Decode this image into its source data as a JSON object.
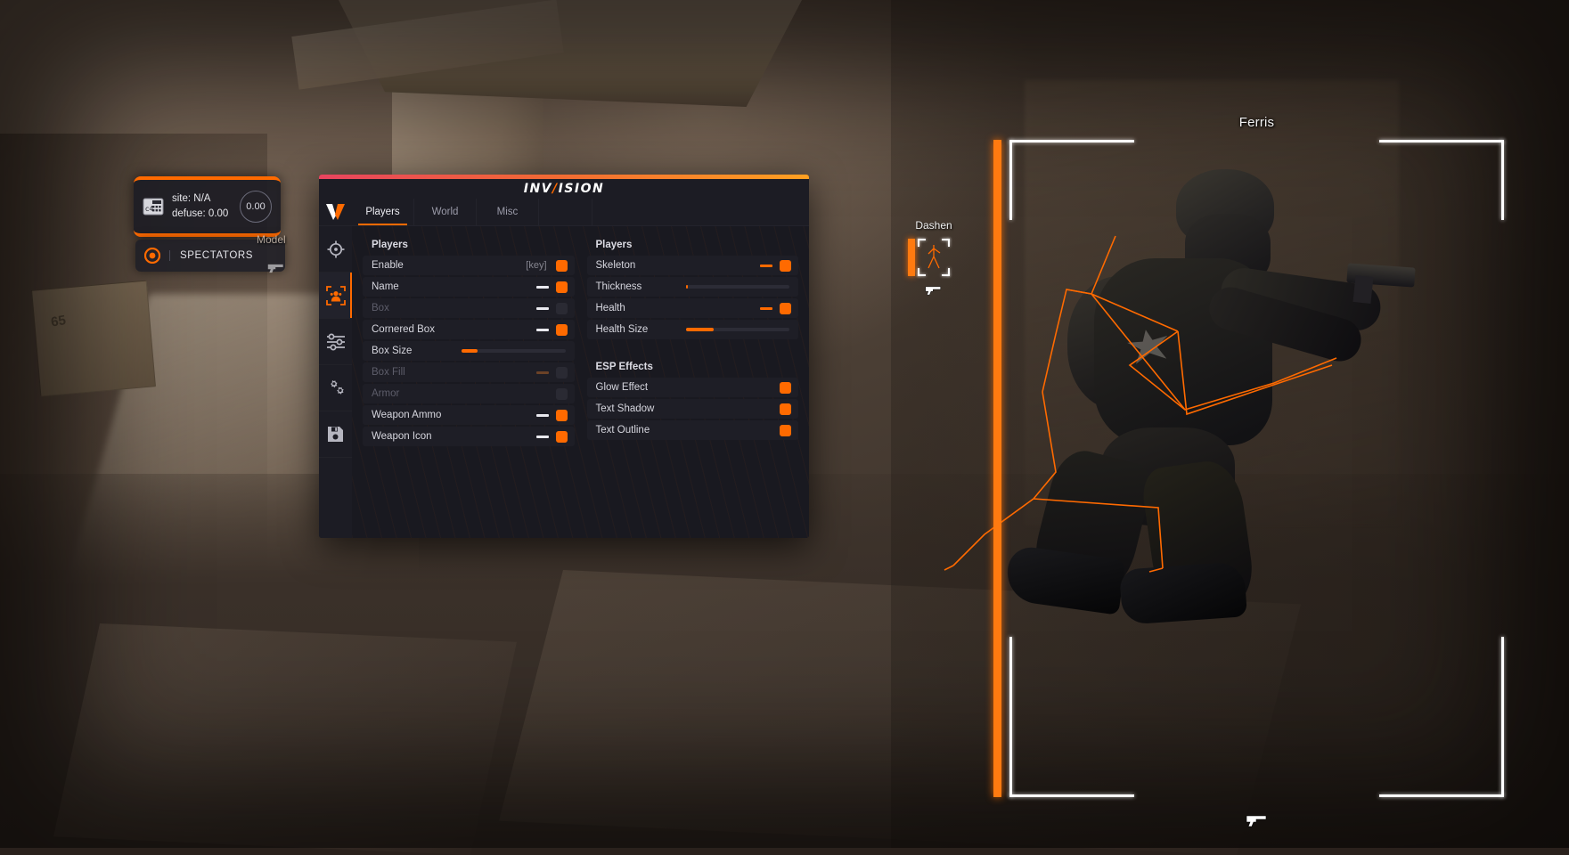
{
  "menu": {
    "brand_pre": "INV",
    "brand_slash": "/",
    "brand_post": "ISION",
    "tabs": [
      {
        "label": "Players",
        "active": true
      },
      {
        "label": "World",
        "active": false
      },
      {
        "label": "Misc",
        "active": false
      }
    ],
    "rail": [
      {
        "icon": "crosshair-icon",
        "active": false
      },
      {
        "icon": "player-esp-icon",
        "active": true
      },
      {
        "icon": "sliders-icon",
        "active": false
      },
      {
        "icon": "gears-icon",
        "active": false
      },
      {
        "icon": "save-icon",
        "active": false
      }
    ],
    "left_column": {
      "group_title": "Players",
      "rows": [
        {
          "label": "Enable",
          "type": "toggle",
          "keybind": "[key]",
          "toggle": true,
          "disabled": false
        },
        {
          "label": "Name",
          "type": "toggle",
          "dash": "white",
          "toggle": true,
          "disabled": false
        },
        {
          "label": "Box",
          "type": "toggle",
          "dash": "white",
          "toggle": false,
          "disabled": true
        },
        {
          "label": "Cornered Box",
          "type": "toggle",
          "dash": "white",
          "toggle": true,
          "disabled": false
        },
        {
          "label": "Box Size",
          "type": "slider",
          "value": 15,
          "disabled": false
        },
        {
          "label": "Box Fill",
          "type": "toggle",
          "dash": "dim",
          "toggle": false,
          "disabled": true
        },
        {
          "label": "Armor",
          "type": "toggle",
          "toggle": false,
          "disabled": true
        },
        {
          "label": "Weapon Ammo",
          "type": "toggle",
          "dash": "white",
          "toggle": true,
          "disabled": false
        },
        {
          "label": "Weapon Icon",
          "type": "toggle",
          "dash": "white",
          "toggle": true,
          "disabled": false
        }
      ]
    },
    "right_column": {
      "group_title": "Players",
      "rows": [
        {
          "label": "Skeleton",
          "type": "toggle",
          "dash": "orange",
          "toggle": true,
          "disabled": false
        },
        {
          "label": "Thickness",
          "type": "slider",
          "value": 2,
          "disabled": false
        },
        {
          "label": "Health",
          "type": "toggle",
          "dash": "orange",
          "toggle": true,
          "disabled": false
        },
        {
          "label": "Health Size",
          "type": "slider",
          "value": 27,
          "disabled": false
        }
      ],
      "effects_title": "ESP Effects",
      "effects_rows": [
        {
          "label": "Glow Effect",
          "type": "toggle",
          "toggle": true,
          "disabled": false
        },
        {
          "label": "Text Shadow",
          "type": "toggle",
          "toggle": true,
          "disabled": false
        },
        {
          "label": "Text Outline",
          "type": "toggle",
          "toggle": true,
          "disabled": false
        }
      ]
    },
    "colors": {
      "accent": "#ff6a00",
      "panel_bg": "#191920",
      "row_bg": "#1e1e26",
      "rail_bg": "#1c1c24"
    }
  },
  "hud": {
    "bomb": {
      "icon": "c4-bomb-icon",
      "site_line": "site: N/A",
      "defuse_line": "defuse: 0.00",
      "timer": "0.00"
    },
    "spectators": {
      "icon": "eye-icon",
      "label": "SPECTATORS"
    },
    "ghost_model_label": "Model"
  },
  "esp": {
    "big_player": {
      "name": "Ferris",
      "health_color": "#ff7a10",
      "box_color": "#ffffff",
      "weapon_icon": "pistol-icon"
    },
    "small_player": {
      "name": "Dashen",
      "health_color": "#ff7a10",
      "box_color": "#ffffff",
      "weapon_icon": "pistol-icon"
    },
    "skeleton_color": "#ff6a00"
  }
}
